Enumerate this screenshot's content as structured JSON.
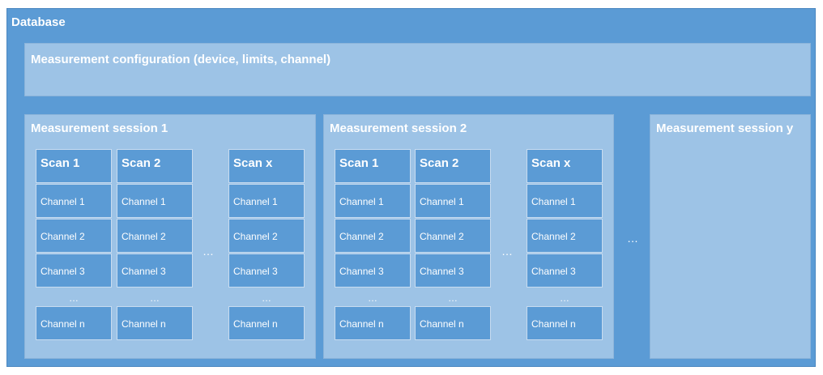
{
  "database": {
    "title": "Database"
  },
  "configuration": {
    "title": "Measurement configuration (device, limits, channel)"
  },
  "sessions": [
    {
      "title": "Measurement session 1",
      "scans": [
        {
          "title": "Scan 1",
          "channels": [
            "Channel 1",
            "Channel 2",
            "Channel 3",
            "Channel n"
          ]
        },
        {
          "title": "Scan 2",
          "channels": [
            "Channel 1",
            "Channel 2",
            "Channel 3",
            "Channel n"
          ]
        },
        {
          "title": "Scan x",
          "channels": [
            "Channel 1",
            "Channel 2",
            "Channel 3",
            "Channel n"
          ]
        }
      ]
    },
    {
      "title": "Measurement session 2",
      "scans": [
        {
          "title": "Scan 1",
          "channels": [
            "Channel 1",
            "Channel 2",
            "Channel 3",
            "Channel n"
          ]
        },
        {
          "title": "Scan 2",
          "channels": [
            "Channel 1",
            "Channel 2",
            "Channel 3",
            "Channel n"
          ]
        },
        {
          "title": "Scan x",
          "channels": [
            "Channel 1",
            "Channel 2",
            "Channel 3",
            "Channel n"
          ]
        }
      ]
    },
    {
      "title": "Measurement session y"
    }
  ],
  "ellipsis": "…",
  "colors": {
    "dark_blue": "#5b9bd5",
    "light_blue": "#9dc3e6",
    "text": "#ffffff"
  }
}
